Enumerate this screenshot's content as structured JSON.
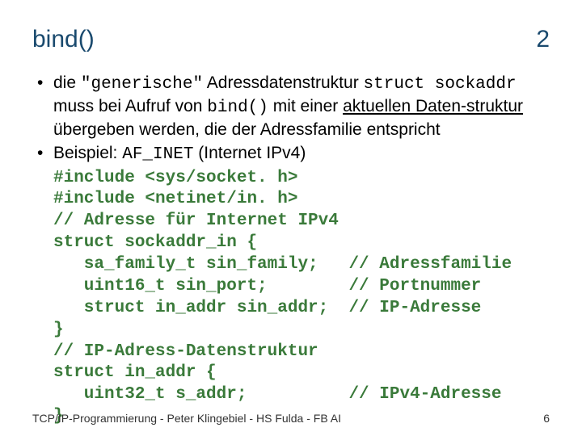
{
  "header": {
    "title": "bind()",
    "page": "2"
  },
  "bullets": {
    "b1_pre": "die ",
    "b1_q1": "\"generische\"",
    "b1_mid1": " Adressdatenstruktur ",
    "b1_code1": "struct sockaddr",
    "b1_mid2": " muss bei Aufruf von ",
    "b1_code2": "bind()",
    "b1_mid3": " mit einer ",
    "b1_ul": "aktuellen Daten-struktur",
    "b1_end": " übergeben werden, die der Adressfamilie entspricht",
    "b2_pre": "Beispiel: ",
    "b2_code": "AF_INET",
    "b2_end": " (Internet IPv4)"
  },
  "code": "#include <sys/socket. h>\n#include <netinet/in. h>\n// Adresse für Internet IPv4\nstruct sockaddr_in {\n   sa_family_t sin_family;   // Adressfamilie\n   uint16_t sin_port;        // Portnummer\n   struct in_addr sin_addr;  // IP-Adresse\n}\n// IP-Adress-Datenstruktur\nstruct in_addr {\n   uint32_t s_addr;          // IPv4-Adresse\n}",
  "footer": {
    "left": "TCP/IP-Programmierung - Peter Klingebiel - HS Fulda - FB AI",
    "right": "6"
  }
}
